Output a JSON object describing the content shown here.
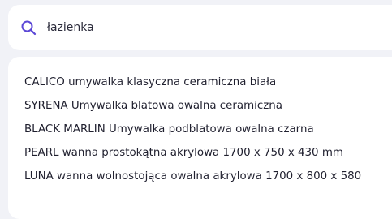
{
  "search": {
    "value": "łazienka",
    "icon": "search-icon",
    "accent_color": "#5b47d6"
  },
  "results": [
    {
      "label": "CALICO umywalka klasyczna ceramiczna biała"
    },
    {
      "label": "SYRENA Umywalka blatowa owalna ceramiczna"
    },
    {
      "label": "BLACK MARLIN Umywalka podblatowa owalna czarna"
    },
    {
      "label": "PEARL wanna prostokątna akrylowa 1700 x 750 x 430 mm"
    },
    {
      "label": "LUNA wanna wolnostojąca owalna akrylowa 1700 x 800 x 580"
    }
  ]
}
